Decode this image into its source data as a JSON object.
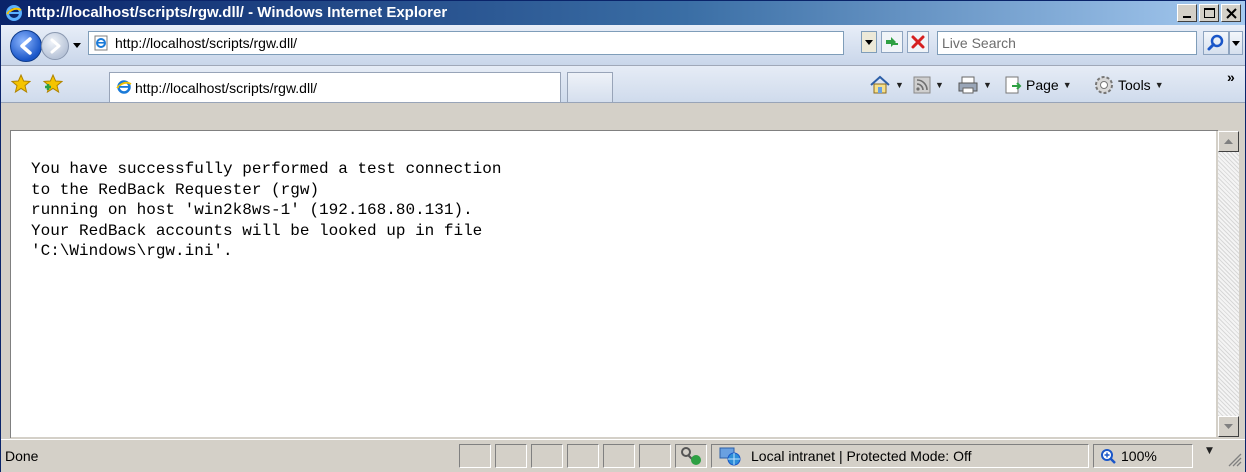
{
  "window": {
    "title": "http://localhost/scripts/rgw.dll/ - Windows Internet Explorer",
    "icons": [
      "ie-icon",
      "minimize-icon",
      "maximize-icon",
      "close-icon"
    ]
  },
  "navigation": {
    "address_value": "http://localhost/scripts/rgw.dll/",
    "search_placeholder": "Live Search"
  },
  "tabs": [
    {
      "label": "http://localhost/scripts/rgw.dll/",
      "active": true
    }
  ],
  "commands": {
    "page_label": "Page",
    "tools_label": "Tools",
    "more_label": "»"
  },
  "page": {
    "lines": [
      "You have successfully performed a test connection",
      "to the RedBack Requester (rgw)",
      "running on host 'win2k8ws-1' (192.168.80.131).",
      "Your RedBack accounts will be looked up in file",
      "'C:\\Windows\\rgw.ini'."
    ]
  },
  "status": {
    "text": "Done",
    "zone": "Local intranet | Protected Mode: Off",
    "zoom": "100%"
  },
  "colors": {
    "title_bar": "#0a246a",
    "chrome": "#d4d0c8",
    "accent": "#1a56c8"
  }
}
